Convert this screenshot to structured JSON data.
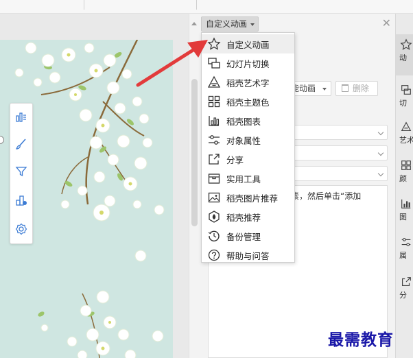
{
  "panel": {
    "header_label": "自定义动画",
    "effect_button_label": "能动画",
    "delete_button_label": "删除",
    "list_hint": "素，然后单击“添加"
  },
  "menu": {
    "items": [
      {
        "label": "自定义动画",
        "icon": "star-animation-icon"
      },
      {
        "label": "幻灯片切换",
        "icon": "slide-transition-icon"
      },
      {
        "label": "稻壳艺术字",
        "icon": "art-text-icon"
      },
      {
        "label": "稻壳主题色",
        "icon": "theme-color-icon"
      },
      {
        "label": "稻壳图表",
        "icon": "chart-icon"
      },
      {
        "label": "对象属性",
        "icon": "properties-icon"
      },
      {
        "label": "分享",
        "icon": "share-icon"
      },
      {
        "label": "实用工具",
        "icon": "toolbox-icon"
      },
      {
        "label": "稻壳图片推荐",
        "icon": "image-icon"
      },
      {
        "label": "稻壳推荐",
        "icon": "recommend-icon"
      },
      {
        "label": "备份管理",
        "icon": "backup-icon"
      },
      {
        "label": "帮助与问答",
        "icon": "help-icon"
      }
    ]
  },
  "side_tabs": [
    {
      "label": "动",
      "icon": "star-icon"
    },
    {
      "label": "切",
      "icon": "transition-icon"
    },
    {
      "label": "艺术",
      "icon": "art-icon"
    },
    {
      "label": "颜",
      "icon": "grid-icon"
    },
    {
      "label": "图",
      "icon": "chart-icon"
    },
    {
      "label": "属",
      "icon": "sliders-icon"
    },
    {
      "label": "分",
      "icon": "share-icon"
    }
  ],
  "float_toolbar": [
    {
      "icon": "chart-icon"
    },
    {
      "icon": "brush-icon"
    },
    {
      "icon": "filter-icon"
    },
    {
      "icon": "object-add-icon"
    },
    {
      "icon": "settings-icon"
    }
  ],
  "watermark": "最需教育",
  "colors": {
    "slide_background": "#cfe6e1",
    "arrow": "#e23b3b",
    "watermark": "#1a18a8",
    "menu_hover": "#eeeeee"
  }
}
